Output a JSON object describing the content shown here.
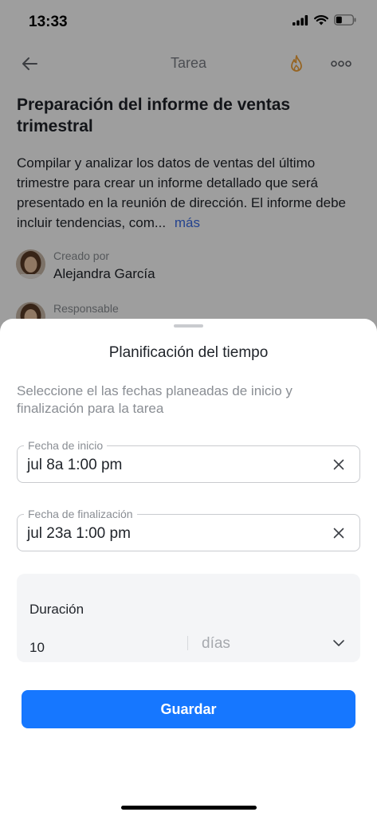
{
  "status_bar": {
    "time": "13:33"
  },
  "topbar": {
    "title": "Tarea",
    "back_icon": "arrow-left-icon",
    "flame_icon": "flame-icon",
    "more_icon": "more-horizontal-icon",
    "accent_color": "#f2a33a"
  },
  "task": {
    "title": "Preparación del informe de ventas trimestral",
    "description": "Compilar y analizar los datos de ventas del último trimestre para crear un informe detallado que será presentado en la reunión de dirección. El informe debe incluir tendencias, com...",
    "more_link": "más"
  },
  "people": {
    "creator": {
      "caption": "Creado por",
      "name": "Alejandra García"
    },
    "assignee": {
      "caption": "Responsable"
    }
  },
  "sheet": {
    "title": "Planificación del tiempo",
    "subtitle": "Seleccione el las fechas planeadas de inicio y finalización para la tarea",
    "start": {
      "label": "Fecha de inicio",
      "value": "jul 8a 1:00 pm"
    },
    "end": {
      "label": "Fecha de finalización",
      "value": "jul 23a 1:00 pm"
    },
    "duration": {
      "label": "Duración",
      "value": "10",
      "unit": "días"
    },
    "save_label": "Guardar",
    "primary_color": "#1677ff"
  }
}
